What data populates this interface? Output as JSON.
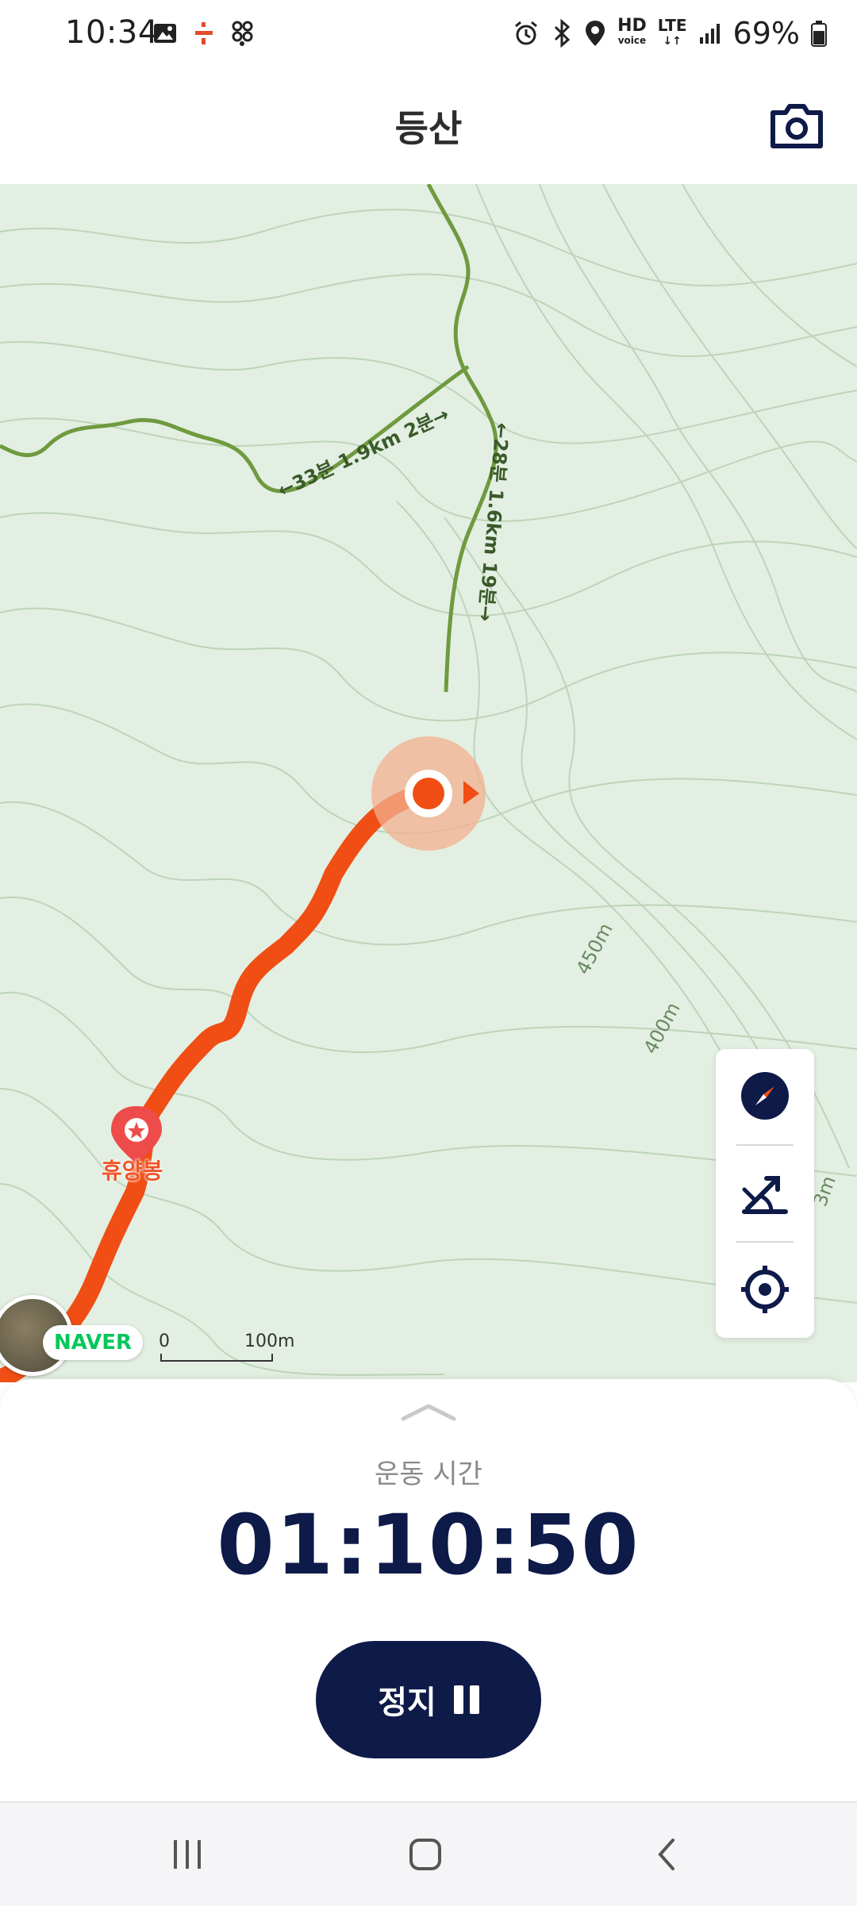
{
  "status_bar": {
    "time": "10:34",
    "battery": "69%",
    "network": "LTE",
    "hd_voice": "HD"
  },
  "header": {
    "title": "등산",
    "camera_icon": "camera-icon"
  },
  "map": {
    "trail_labels": [
      "←33분 1.9km 2분→",
      "←28분 1.6km 19분→"
    ],
    "contour_labels": [
      "450m",
      "400m",
      "3m"
    ],
    "peak_name": "휴양봉",
    "naver_badge": "NAVER",
    "scale_zero": "0",
    "scale_max": "100m",
    "route_color": "#f04e14",
    "trail_color": "#6f9a3f",
    "controls": [
      "compass-icon",
      "elevation-icon",
      "locate-icon"
    ]
  },
  "sheet": {
    "label": "운동 시간",
    "timer": "01:10:50",
    "stop_button": "정지"
  },
  "nav": {
    "recents": "recents-icon",
    "home": "home-icon",
    "back": "back-icon"
  },
  "colors": {
    "accent": "#0e1a48",
    "route": "#f04e14"
  }
}
